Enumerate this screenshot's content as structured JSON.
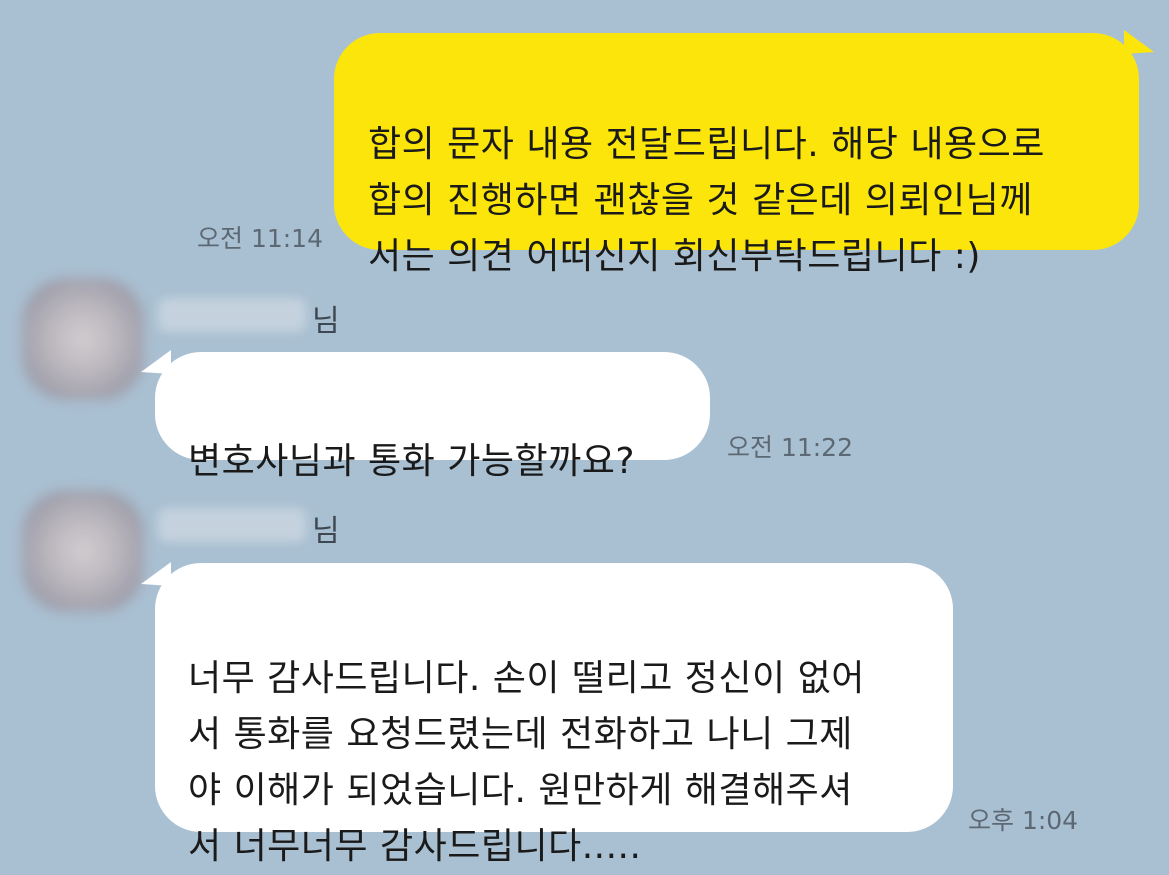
{
  "messages": [
    {
      "direction": "outgoing",
      "text": "합의 문자 내용 전달드립니다. 해당 내용으로\n합의 진행하면 괜찮을 것 같은데 의뢰인님께\n서는 의견 어떠신지 회신부탁드립니다 :)",
      "time": "오전 11:14"
    },
    {
      "direction": "incoming",
      "sender_suffix": "님",
      "text": "변호사님과 통화 가능할까요?",
      "time": "오전 11:22"
    },
    {
      "direction": "incoming",
      "sender_suffix": "님",
      "text": "너무 감사드립니다. 손이 떨리고 정신이 없어\n서 통화를 요청드렸는데 전화하고 나니 그제\n야 이해가 되었습니다. 원만하게 해결해주셔\n서 너무너무 감사드립니다.....",
      "time": "오후 1:04"
    }
  ],
  "colors": {
    "background": "#a9c0d2",
    "outgoing_bubble": "#fbe50b",
    "incoming_bubble": "#ffffff",
    "time_text": "#5c6873"
  }
}
